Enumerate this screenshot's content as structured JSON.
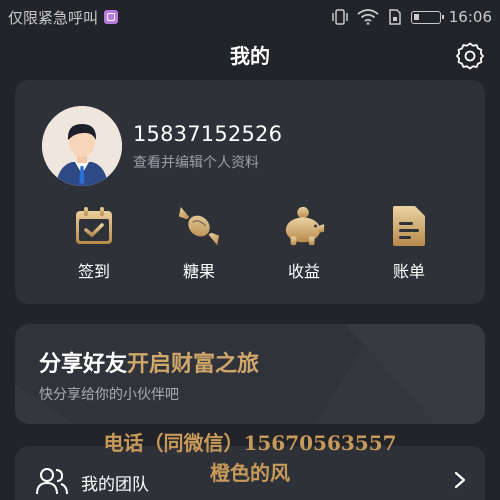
{
  "status_bar": {
    "carrier": "仅限紧急呼叫",
    "time": "16:06"
  },
  "header": {
    "title": "我的",
    "settings_icon": "gear-icon"
  },
  "profile": {
    "phone": "15837152526",
    "edit_text": "查看并编辑个人资料",
    "avatar_icon": "user-avatar"
  },
  "actions": [
    {
      "label": "签到",
      "icon": "calendar-check-icon"
    },
    {
      "label": "糖果",
      "icon": "candy-icon"
    },
    {
      "label": "收益",
      "icon": "piggy-bank-icon"
    },
    {
      "label": "账单",
      "icon": "bill-icon"
    }
  ],
  "share_banner": {
    "title_part1": "分享好友",
    "title_part2": "开启财富之旅",
    "subtitle": "快分享给你的小伙伴吧"
  },
  "watermark": {
    "line1": "电话（同微信）15670563557",
    "line2": "橙色的风"
  },
  "menu": {
    "team_label": "我的团队",
    "team_icon": "team-icon"
  },
  "colors": {
    "background": "#222429",
    "card": "#2f3139",
    "accent_gold": "#cfa76a",
    "watermark": "#c89a5a"
  }
}
